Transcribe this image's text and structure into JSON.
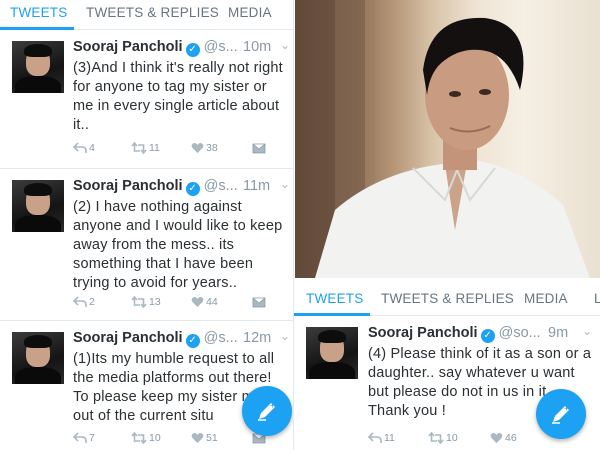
{
  "left": {
    "tabs": [
      {
        "label": "TWEETS",
        "active": true
      },
      {
        "label": "TWEETS & REPLIES",
        "active": false
      },
      {
        "label": "MEDIA",
        "active": false
      }
    ],
    "tweets": [
      {
        "name": "Sooraj Pancholi",
        "handle": "@s...",
        "time": "10m",
        "text": "(3)And I think it's really not right for anyone to tag my sister or me in every single article about it..",
        "replies": "4",
        "retweets": "11",
        "likes": "38"
      },
      {
        "name": "Sooraj Pancholi",
        "handle": "@s...",
        "time": "11m",
        "text": "(2) I have nothing against anyone and I would like to keep away from the mess.. its something that I have been trying to avoid for years..",
        "replies": "2",
        "retweets": "13",
        "likes": "44"
      },
      {
        "name": "Sooraj Pancholi",
        "handle": "@s...",
        "time": "12m",
        "text": "(1)Its my humble request to all the media platforms out there! To please keep my sister me out of the current situ",
        "replies": "7",
        "retweets": "10",
        "likes": "51"
      }
    ]
  },
  "right": {
    "tabs": [
      {
        "label": "TWEETS",
        "active": true
      },
      {
        "label": "TWEETS & REPLIES",
        "active": false
      },
      {
        "label": "MEDIA",
        "active": false
      },
      {
        "label": "L",
        "active": false
      }
    ],
    "tweets": [
      {
        "name": "Sooraj Pancholi",
        "handle": "@so...",
        "time": "9m",
        "text": "(4) Please think of it as a son or a daughter.. say whatever u want but please do not in us in it.. Thank you !",
        "replies": "11",
        "retweets": "10",
        "likes": "46"
      }
    ]
  },
  "icons": {
    "verified": "verified-badge-icon",
    "reply": "reply-icon",
    "retweet": "retweet-icon",
    "like": "heart-icon",
    "dm": "envelope-icon",
    "compose": "compose-tweet-icon",
    "more": "chevron-down-icon"
  },
  "colors": {
    "accent": "#1da1f2",
    "muted": "#8899a6",
    "text": "#292f33",
    "divider": "#e1e8ed"
  }
}
